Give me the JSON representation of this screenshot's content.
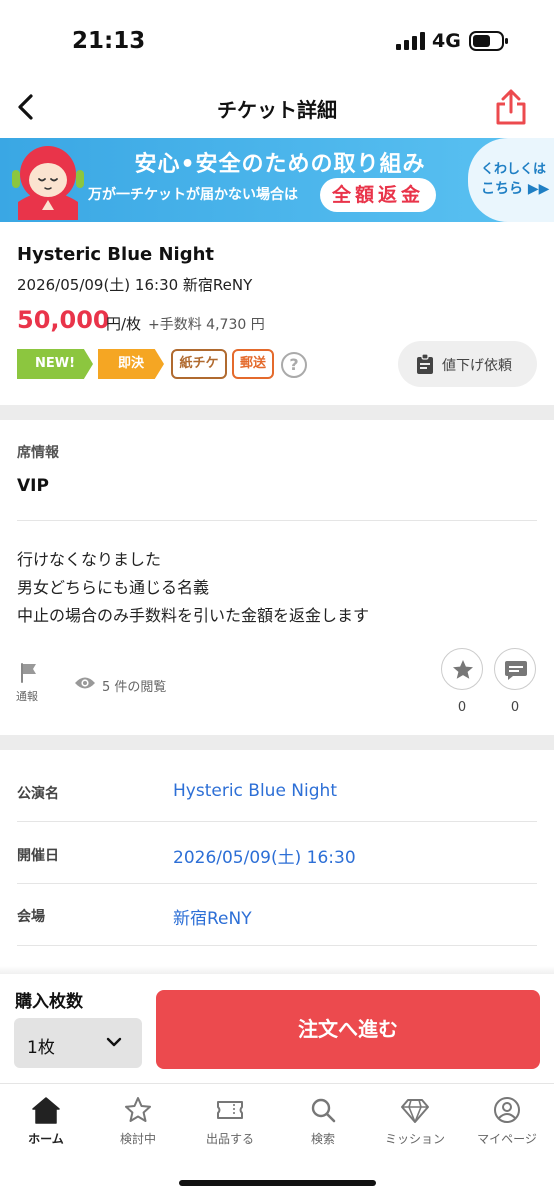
{
  "status_bar": {
    "time": "21:13",
    "network": "4G"
  },
  "nav": {
    "title": "チケット詳細"
  },
  "banner": {
    "line1": "安心•安全のための取り組み",
    "line2": "万が一チケットが届かない場合は",
    "refund": "全額返金",
    "more_line1": "くわしくは",
    "more_line2": "こちら ▶▶"
  },
  "event": {
    "title": "Hysteric Blue Night",
    "date_venue": "2026/05/09(土) 16:30 新宿ReNY",
    "price": "50,000",
    "price_unit": "円/枚",
    "fee": "+手数料 4,730 円"
  },
  "tags": {
    "new": "NEW!",
    "sokketsu": "即決",
    "paper": "紙チケ",
    "post": "郵送"
  },
  "price_down_label": "値下げ依頼",
  "seat": {
    "heading": "席情報",
    "value": "VIP"
  },
  "description": [
    "行けなくなりました",
    "男女どちらにも通じる名義",
    "中止の場合のみ手数料を引いた金額を返金します"
  ],
  "actions": {
    "report": "通報",
    "views": "5 件の閲覧",
    "fav_count": "0",
    "comment_count": "0"
  },
  "details": [
    {
      "label": "公演名",
      "value": "Hysteric Blue Night"
    },
    {
      "label": "開催日",
      "value": "2026/05/09(土) 16:30"
    },
    {
      "label": "会場",
      "value": "新宿ReNY"
    }
  ],
  "purchase": {
    "qty_label": "購入枚数",
    "qty_value": "1枚",
    "order_button": "注文へ進む"
  },
  "tabs": [
    {
      "label": "ホーム",
      "icon": "home-icon"
    },
    {
      "label": "検討中",
      "icon": "star-icon"
    },
    {
      "label": "出品する",
      "icon": "ticket-icon"
    },
    {
      "label": "検索",
      "icon": "search-icon"
    },
    {
      "label": "ミッション",
      "icon": "diamond-icon"
    },
    {
      "label": "マイページ",
      "icon": "user-icon"
    }
  ],
  "colors": {
    "accent_red": "#ec4a4e",
    "price_red": "#e9344a",
    "link_blue": "#2d6fd6",
    "banner_blue": "#3aa7e4",
    "tag_green": "#8cc63f",
    "tag_orange": "#f5a623"
  }
}
